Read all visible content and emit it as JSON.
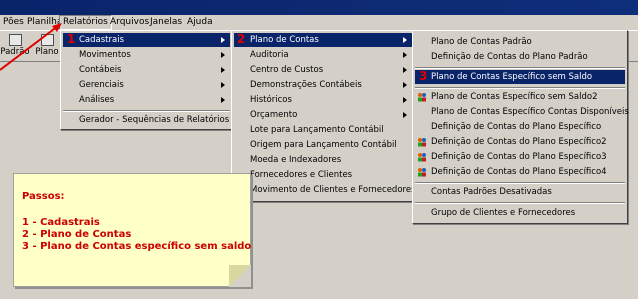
{
  "menubar": {
    "items": [
      "Pões",
      "Planilhas",
      "Relatórios",
      "Arquivos",
      "Janelas",
      "Ajuda"
    ]
  },
  "toolbar": {
    "buttons": [
      "Padrão",
      "Plano"
    ]
  },
  "menu_level1": {
    "items": [
      "Cadastrais",
      "Movimentos",
      "Contábeis",
      "Gerenciais",
      "Análises",
      "Gerador - Sequências de Relatórios"
    ]
  },
  "menu_level2": {
    "items": [
      "Plano de Contas",
      "Auditoria",
      "Centro de Custos",
      "Demonstrações Contábeis",
      "Históricos",
      "Orçamento",
      "Lote para Lançamento Contábil",
      "Origem para Lançamento Contábil",
      "Moeda e Indexadores",
      "Fornecedores e Clientes",
      "Movimento de Clientes e Fornecedores"
    ]
  },
  "menu_level3": {
    "items": [
      "Plano de Contas Padrão",
      "Definição de Contas do Plano Padrão",
      "Plano de Contas Específico sem Saldo",
      "Plano de Contas Específico sem Saldo2",
      "Plano de Contas Específico Contas Disponíveis",
      "Definição de Contas do Plano Específico",
      "Definição de Contas do Plano Específico2",
      "Definição de Contas do Plano Específico3",
      "Definição de Contas do Plano Específico4",
      "Contas Padrões Desativadas",
      "Grupo de Clientes e Fornecedores"
    ]
  },
  "steps": {
    "numbers": [
      "1",
      "2",
      "3"
    ]
  },
  "note": {
    "title": "Passos:",
    "lines": [
      "1 - Cadastrais",
      "2 - Plano de Contas",
      "3 - Plano de Contas específico sem saldo"
    ]
  },
  "colors": {
    "highlight": "#0a246a",
    "annotation_red": "#e00000",
    "note_bg": "#ffffc8"
  }
}
